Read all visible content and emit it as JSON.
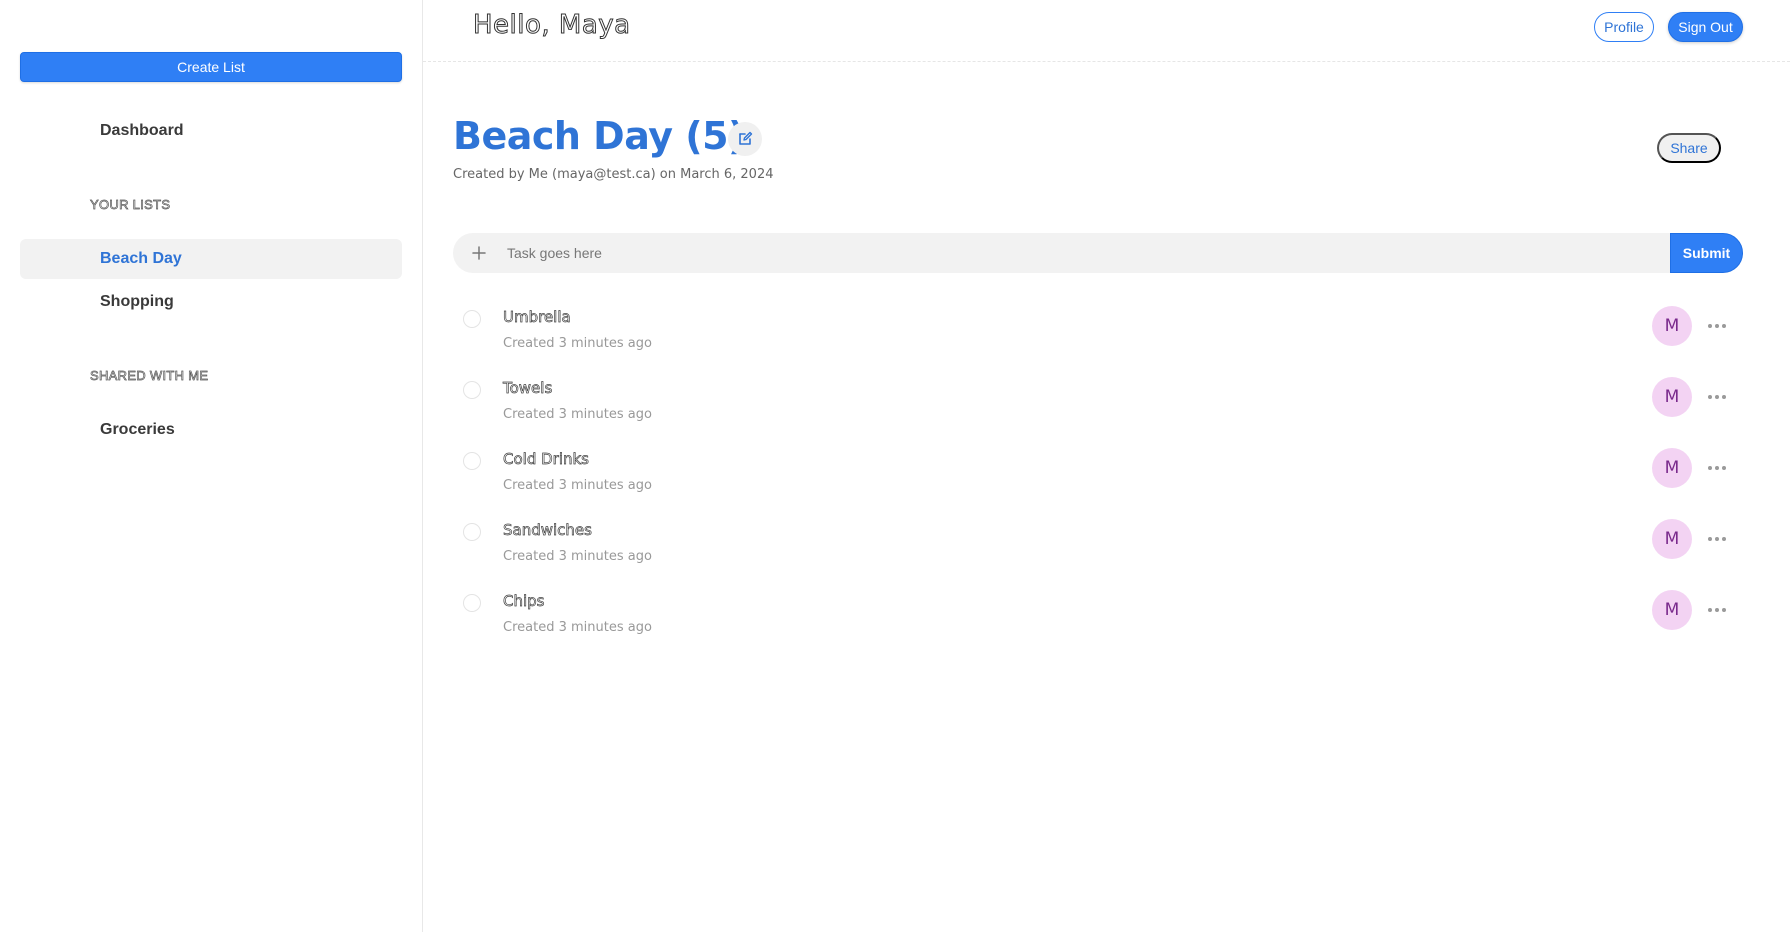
{
  "sidebar": {
    "create_label": "Create List",
    "dashboard": "Dashboard",
    "your_lists_label": "YOUR LISTS",
    "your_lists": [
      "Beach Day",
      "Shopping"
    ],
    "shared_label": "SHARED WITH ME",
    "shared_lists": [
      "Groceries"
    ]
  },
  "header": {
    "greeting": "Hello, Maya",
    "profile_label": "Profile",
    "signout_label": "Sign Out"
  },
  "list": {
    "title": "Beach Day (5)",
    "subtitle": "Created by Me (maya@test.ca) on March 6, 2024",
    "share_label": "Share",
    "input_placeholder": "Task goes here",
    "submit_label": "Submit"
  },
  "tasks": [
    {
      "name": "Umbrella",
      "meta": "Created 3 minutes ago",
      "avatar": "M"
    },
    {
      "name": "Towels",
      "meta": "Created 3 minutes ago",
      "avatar": "M"
    },
    {
      "name": "Cold Drinks",
      "meta": "Created 3 minutes ago",
      "avatar": "M"
    },
    {
      "name": "Sandwiches",
      "meta": "Created 3 minutes ago",
      "avatar": "M"
    },
    {
      "name": "Chips",
      "meta": "Created 3 minutes ago",
      "avatar": "M"
    }
  ],
  "colors": {
    "accent": "#2f7ff5",
    "title": "#2f74d6",
    "avatar_bg": "#f3d3f3"
  },
  "icons": {
    "edit": "edit-icon",
    "plus": "plus-icon",
    "more": "more-horizontal-icon"
  }
}
